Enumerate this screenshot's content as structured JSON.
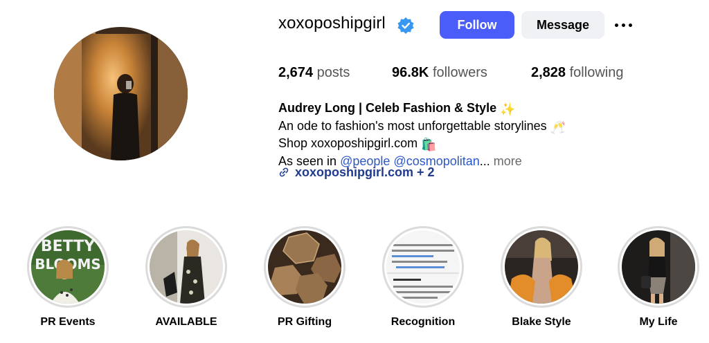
{
  "profile": {
    "username": "xoxoposhipgirl",
    "verified_icon": "verified-badge-icon",
    "follow_label": "Follow",
    "message_label": "Message",
    "more_icon": "more-options-icon"
  },
  "stats": {
    "posts_count": "2,674",
    "posts_label": "posts",
    "followers_count": "96.8K",
    "followers_label": "followers",
    "following_count": "2,828",
    "following_label": "following"
  },
  "bio": {
    "name": "Audrey Long | Celeb Fashion & Style",
    "line1": "An ode to fashion's most unforgettable storylines",
    "line2": "Shop xoxoposhipgirl.com",
    "line3_prefix": "As seen in",
    "mention1": "@people",
    "mention2": "@cosmopolitan",
    "ellipsis": "...",
    "more_label": "more",
    "sparkles_emoji": "✨",
    "champagne_emoji": "🥂",
    "bag_emoji": "🛍️"
  },
  "link": {
    "icon": "link-icon",
    "text": "xoxoposhipgirl.com + 2"
  },
  "highlights": [
    {
      "label": "PR Events"
    },
    {
      "label": "AVAILABLE"
    },
    {
      "label": "PR Gifting"
    },
    {
      "label": "Recognition"
    },
    {
      "label": "Blake Style"
    },
    {
      "label": "My Life"
    }
  ],
  "colors": {
    "follow_button": "#4a5df9",
    "message_button": "#eff1f5",
    "verified_badge": "#3897f0",
    "mention": "#2b57c8",
    "link": "#1f3b8f",
    "highlight_ring": "#dbdbdb"
  }
}
